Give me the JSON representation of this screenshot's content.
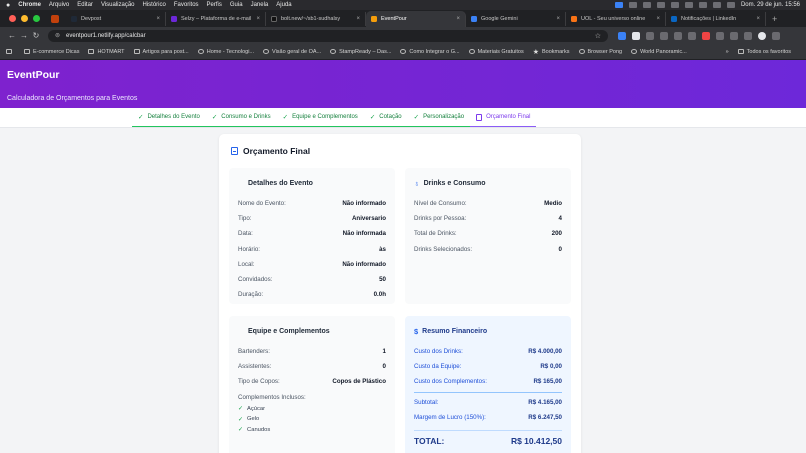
{
  "menubar": {
    "app": "Chrome",
    "items": [
      "Arquivo",
      "Editar",
      "Visualização",
      "Histórico",
      "Favoritos",
      "Perfis",
      "Guia",
      "Janela",
      "Ajuda"
    ],
    "clock": "Dom. 29 de jun.  15:56"
  },
  "tabs": [
    {
      "title": "Devpost",
      "color": "#1f2937"
    },
    {
      "title": "Selzy – Plataforma de e-mail",
      "color": "#6d28d9"
    },
    {
      "title": "bolt.new/~/sb1-sudhalsy",
      "color": "#111111"
    },
    {
      "title": "EventPour",
      "color": "#f59e0b",
      "active": true
    },
    {
      "title": "Google Gemini",
      "color": "#3b82f6"
    },
    {
      "title": "UOL - Seu universo online",
      "color": "#f97316"
    },
    {
      "title": "Notificações | LinkedIn",
      "color": "#0a66c2"
    }
  ],
  "address": {
    "url": "eventpour1.netlify.app/calcbar"
  },
  "bookmarks": [
    {
      "label": "E-commerce Dicas",
      "icon": "folder-icon"
    },
    {
      "label": "HOTMART",
      "icon": "folder-icon"
    },
    {
      "label": "Artigos para post...",
      "icon": "folder-icon"
    },
    {
      "label": "Home - Tecnologi...",
      "icon": "site-icon"
    },
    {
      "label": "Visão geral de OA...",
      "icon": "site-icon"
    },
    {
      "label": "StampReady – Das...",
      "icon": "site-icon"
    },
    {
      "label": "Como Integrar o G...",
      "icon": "site-icon"
    },
    {
      "label": "Materiais Gratuitos",
      "icon": "site-icon"
    },
    {
      "label": "Bookmarks",
      "icon": "star-icon"
    },
    {
      "label": "Browser Pong",
      "icon": "site-icon"
    },
    {
      "label": "World Panoramic...",
      "icon": "site-icon"
    }
  ],
  "bookmarks_more": "»",
  "bookmarks_all": "Todos os favoritos",
  "app": {
    "title": "EventPour",
    "subtitle": "Calculadora de Orçamentos para Eventos",
    "accent": "#7e22ce"
  },
  "steps": [
    {
      "label": "Detalhes do Evento",
      "done": true
    },
    {
      "label": "Consumo e Drinks",
      "done": true
    },
    {
      "label": "Equipe e Complementos",
      "done": true
    },
    {
      "label": "Cotação",
      "done": true
    },
    {
      "label": "Personalização",
      "done": true
    },
    {
      "label": "Orçamento Final",
      "active": true
    }
  ],
  "budget": {
    "title": "Orçamento Final",
    "event": {
      "title": "Detalhes do Evento",
      "rows": [
        {
          "label": "Nome do Evento:",
          "value": "Não informado"
        },
        {
          "label": "Tipo:",
          "value": "Aniversario"
        },
        {
          "label": "Data:",
          "value": "Não informada"
        },
        {
          "label": "Horário:",
          "value": "às"
        },
        {
          "label": "Local:",
          "value": "Não informado"
        },
        {
          "label": "Convidados:",
          "value": "50"
        },
        {
          "label": "Duração:",
          "value": "0.0h"
        }
      ]
    },
    "drinks": {
      "title": "Drinks e Consumo",
      "rows": [
        {
          "label": "Nível de Consumo:",
          "value": "Medio"
        },
        {
          "label": "Drinks por Pessoa:",
          "value": "4"
        },
        {
          "label": "Total de Drinks:",
          "value": "200"
        },
        {
          "label": "Drinks Selecionados:",
          "value": "0"
        }
      ]
    },
    "team": {
      "title": "Equipe e Complementos",
      "rows": [
        {
          "label": "Bartenders:",
          "value": "1"
        },
        {
          "label": "Assistentes:",
          "value": "0"
        },
        {
          "label": "Tipo de Copos:",
          "value": "Copos de Plástico"
        }
      ],
      "included_label": "Complementos Inclusos:",
      "included": [
        "Açúcar",
        "Gelo",
        "Canudos"
      ]
    },
    "finance": {
      "title": "Resumo Financeiro",
      "rows": [
        {
          "label": "Custo dos Drinks:",
          "value": "R$ 4.000,00"
        },
        {
          "label": "Custo da Equipe:",
          "value": "R$ 0,00"
        },
        {
          "label": "Custo dos Complementos:",
          "value": "R$ 165,00"
        }
      ],
      "subtotal": {
        "label": "Subtotal:",
        "value": "R$ 4.165,00"
      },
      "margin": {
        "label": "Margem de Lucro (150%):",
        "value": "R$ 6.247,50"
      },
      "total": {
        "label": "TOTAL:",
        "value": "R$ 10.412,50"
      }
    }
  }
}
